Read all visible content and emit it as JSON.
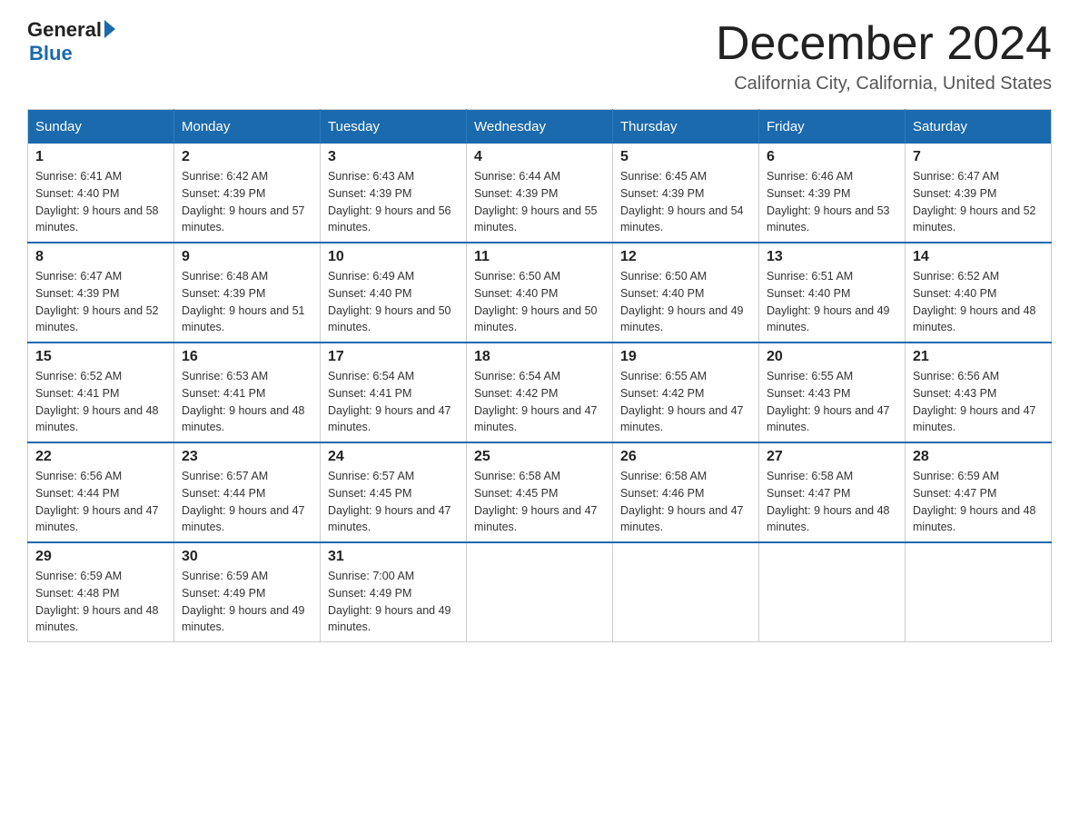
{
  "logo": {
    "general": "General",
    "blue": "Blue"
  },
  "title": "December 2024",
  "subtitle": "California City, California, United States",
  "days_of_week": [
    "Sunday",
    "Monday",
    "Tuesday",
    "Wednesday",
    "Thursday",
    "Friday",
    "Saturday"
  ],
  "weeks": [
    [
      {
        "day": "1",
        "sunrise": "6:41 AM",
        "sunset": "4:40 PM",
        "daylight": "9 hours and 58 minutes."
      },
      {
        "day": "2",
        "sunrise": "6:42 AM",
        "sunset": "4:39 PM",
        "daylight": "9 hours and 57 minutes."
      },
      {
        "day": "3",
        "sunrise": "6:43 AM",
        "sunset": "4:39 PM",
        "daylight": "9 hours and 56 minutes."
      },
      {
        "day": "4",
        "sunrise": "6:44 AM",
        "sunset": "4:39 PM",
        "daylight": "9 hours and 55 minutes."
      },
      {
        "day": "5",
        "sunrise": "6:45 AM",
        "sunset": "4:39 PM",
        "daylight": "9 hours and 54 minutes."
      },
      {
        "day": "6",
        "sunrise": "6:46 AM",
        "sunset": "4:39 PM",
        "daylight": "9 hours and 53 minutes."
      },
      {
        "day": "7",
        "sunrise": "6:47 AM",
        "sunset": "4:39 PM",
        "daylight": "9 hours and 52 minutes."
      }
    ],
    [
      {
        "day": "8",
        "sunrise": "6:47 AM",
        "sunset": "4:39 PM",
        "daylight": "9 hours and 52 minutes."
      },
      {
        "day": "9",
        "sunrise": "6:48 AM",
        "sunset": "4:39 PM",
        "daylight": "9 hours and 51 minutes."
      },
      {
        "day": "10",
        "sunrise": "6:49 AM",
        "sunset": "4:40 PM",
        "daylight": "9 hours and 50 minutes."
      },
      {
        "day": "11",
        "sunrise": "6:50 AM",
        "sunset": "4:40 PM",
        "daylight": "9 hours and 50 minutes."
      },
      {
        "day": "12",
        "sunrise": "6:50 AM",
        "sunset": "4:40 PM",
        "daylight": "9 hours and 49 minutes."
      },
      {
        "day": "13",
        "sunrise": "6:51 AM",
        "sunset": "4:40 PM",
        "daylight": "9 hours and 49 minutes."
      },
      {
        "day": "14",
        "sunrise": "6:52 AM",
        "sunset": "4:40 PM",
        "daylight": "9 hours and 48 minutes."
      }
    ],
    [
      {
        "day": "15",
        "sunrise": "6:52 AM",
        "sunset": "4:41 PM",
        "daylight": "9 hours and 48 minutes."
      },
      {
        "day": "16",
        "sunrise": "6:53 AM",
        "sunset": "4:41 PM",
        "daylight": "9 hours and 48 minutes."
      },
      {
        "day": "17",
        "sunrise": "6:54 AM",
        "sunset": "4:41 PM",
        "daylight": "9 hours and 47 minutes."
      },
      {
        "day": "18",
        "sunrise": "6:54 AM",
        "sunset": "4:42 PM",
        "daylight": "9 hours and 47 minutes."
      },
      {
        "day": "19",
        "sunrise": "6:55 AM",
        "sunset": "4:42 PM",
        "daylight": "9 hours and 47 minutes."
      },
      {
        "day": "20",
        "sunrise": "6:55 AM",
        "sunset": "4:43 PM",
        "daylight": "9 hours and 47 minutes."
      },
      {
        "day": "21",
        "sunrise": "6:56 AM",
        "sunset": "4:43 PM",
        "daylight": "9 hours and 47 minutes."
      }
    ],
    [
      {
        "day": "22",
        "sunrise": "6:56 AM",
        "sunset": "4:44 PM",
        "daylight": "9 hours and 47 minutes."
      },
      {
        "day": "23",
        "sunrise": "6:57 AM",
        "sunset": "4:44 PM",
        "daylight": "9 hours and 47 minutes."
      },
      {
        "day": "24",
        "sunrise": "6:57 AM",
        "sunset": "4:45 PM",
        "daylight": "9 hours and 47 minutes."
      },
      {
        "day": "25",
        "sunrise": "6:58 AM",
        "sunset": "4:45 PM",
        "daylight": "9 hours and 47 minutes."
      },
      {
        "day": "26",
        "sunrise": "6:58 AM",
        "sunset": "4:46 PM",
        "daylight": "9 hours and 47 minutes."
      },
      {
        "day": "27",
        "sunrise": "6:58 AM",
        "sunset": "4:47 PM",
        "daylight": "9 hours and 48 minutes."
      },
      {
        "day": "28",
        "sunrise": "6:59 AM",
        "sunset": "4:47 PM",
        "daylight": "9 hours and 48 minutes."
      }
    ],
    [
      {
        "day": "29",
        "sunrise": "6:59 AM",
        "sunset": "4:48 PM",
        "daylight": "9 hours and 48 minutes."
      },
      {
        "day": "30",
        "sunrise": "6:59 AM",
        "sunset": "4:49 PM",
        "daylight": "9 hours and 49 minutes."
      },
      {
        "day": "31",
        "sunrise": "7:00 AM",
        "sunset": "4:49 PM",
        "daylight": "9 hours and 49 minutes."
      },
      null,
      null,
      null,
      null
    ]
  ]
}
